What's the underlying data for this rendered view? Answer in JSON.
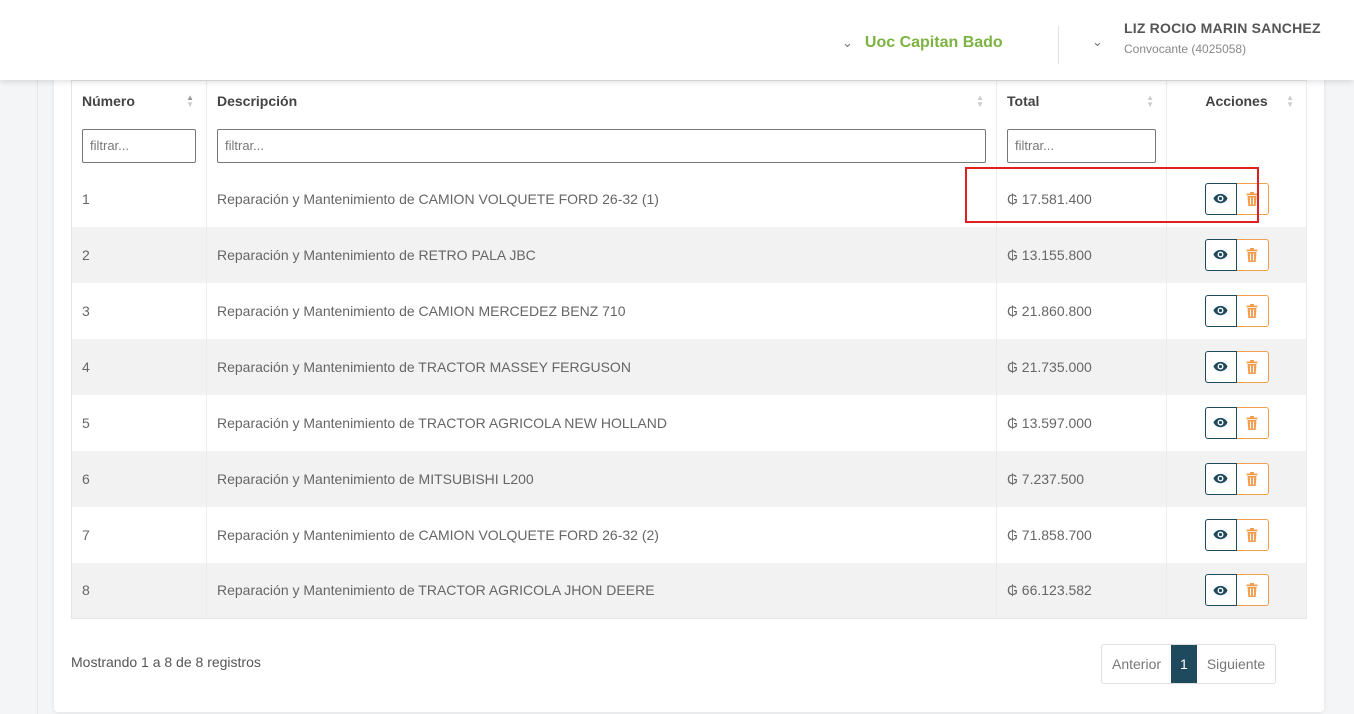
{
  "header": {
    "org_selector": {
      "label": "Uoc Capitan Bado"
    },
    "user": {
      "name": "LIZ ROCIO MARIN SANCHEZ",
      "role": "Convocante (4025058)"
    }
  },
  "table": {
    "columns": {
      "numero": "Número",
      "descripcion": "Descripción",
      "total": "Total",
      "acciones": "Acciones"
    },
    "filter_placeholder": "filtrar...",
    "rows": [
      {
        "numero": "1",
        "descripcion": "Reparación y Mantenimiento de CAMION VOLQUETE FORD 26-32 (1)",
        "total": "₲ 17.581.400"
      },
      {
        "numero": "2",
        "descripcion": "Reparación y Mantenimiento de RETRO PALA JBC",
        "total": "₲ 13.155.800"
      },
      {
        "numero": "3",
        "descripcion": "Reparación y Mantenimiento de CAMION MERCEDEZ BENZ 710",
        "total": "₲ 21.860.800"
      },
      {
        "numero": "4",
        "descripcion": "Reparación y Mantenimiento de TRACTOR MASSEY FERGUSON",
        "total": "₲ 21.735.000"
      },
      {
        "numero": "5",
        "descripcion": "Reparación y Mantenimiento de TRACTOR AGRICOLA NEW HOLLAND",
        "total": "₲ 13.597.000"
      },
      {
        "numero": "6",
        "descripcion": "Reparación y Mantenimiento de MITSUBISHI L200",
        "total": "₲ 7.237.500"
      },
      {
        "numero": "7",
        "descripcion": "Reparación y Mantenimiento de CAMION VOLQUETE FORD 26-32 (2)",
        "total": "₲ 71.858.700"
      },
      {
        "numero": "8",
        "descripcion": "Reparación y Mantenimiento de TRACTOR AGRICOLA JHON DEERE",
        "total": "₲ 66.123.582"
      }
    ]
  },
  "footer": {
    "info": "Mostrando 1 a 8 de 8 registros",
    "pagination": {
      "previous": "Anterior",
      "current": "1",
      "next": "Siguiente"
    }
  },
  "icons": {
    "view": "eye-icon",
    "delete": "trash-icon"
  },
  "colors": {
    "accent_green": "#7cb342",
    "primary_dark": "#1f4a5e",
    "delete_orange": "#f0a050",
    "highlight_red": "#e02020"
  }
}
